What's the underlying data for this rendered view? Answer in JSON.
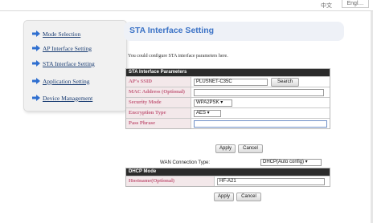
{
  "topbar": {
    "lang_zh": "中文",
    "lang_en": "Engl…"
  },
  "sidebar": {
    "items": [
      {
        "label": "Mode Selection"
      },
      {
        "label": "AP Interface Setting"
      },
      {
        "label": "STA Interface Setting"
      },
      {
        "label": "Application Setting"
      },
      {
        "label": "Device Management"
      }
    ]
  },
  "header": {
    "title": "STA Interface Setting"
  },
  "description": "You could configure STA interface parameters here.",
  "sta_table": {
    "heading": "STA Interface Parameters",
    "rows": [
      {
        "label": "AP's SSID",
        "value": "PLUSNET-C35C"
      },
      {
        "label": "MAC Address (Optional)",
        "value": ""
      },
      {
        "label": "Security Mode",
        "value": "WPA2PSK ▾"
      },
      {
        "label": "Encryption Type",
        "value": "AES ▾"
      },
      {
        "label": "Pass Phrase",
        "value": ""
      }
    ],
    "search_label": "Search"
  },
  "buttons": {
    "apply": "Apply",
    "cancel": "Cancel"
  },
  "wan": {
    "label": "WAN Connection Type:",
    "value": "DHCP(Auto config) ▾"
  },
  "dhcp_table": {
    "heading": "DHCP Mode",
    "hostname_label": "Hostname(Optional)",
    "hostname_value": "HF-A21"
  },
  "colors": {
    "accent": "#3c73c6",
    "label_text": "#c4607e",
    "label_bg": "#f3e8ea",
    "table_header": "#2b2b2b"
  }
}
